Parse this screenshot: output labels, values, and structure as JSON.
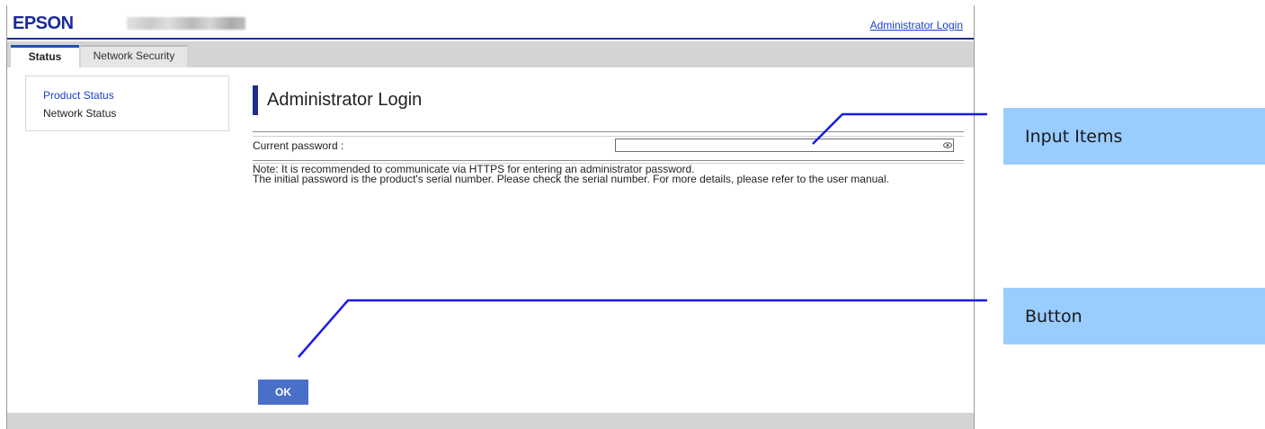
{
  "header": {
    "logo": "EPSON",
    "admin_link": "Administrator Login"
  },
  "tabs": [
    {
      "label": "Status",
      "active": true
    },
    {
      "label": "Network Security",
      "active": false
    }
  ],
  "sidebar": {
    "items": [
      {
        "label": "Product Status",
        "active": true
      },
      {
        "label": "Network Status",
        "active": false
      }
    ]
  },
  "main": {
    "title": "Administrator Login",
    "password_label": "Current password :",
    "password_value": "",
    "note_line1": "Note: It is recommended to communicate via HTTPS for entering an administrator password.",
    "note_line2": "The initial password is the product's serial number. Please check the serial number. For more details, please refer to the user manual.",
    "ok_label": "OK"
  },
  "callouts": {
    "input_items": "Input Items",
    "button": "Button"
  },
  "colors": {
    "brand": "#1a2a9c",
    "link": "#1a3fd1",
    "ok_button": "#4a6fc9",
    "callout_bg": "#99ccff",
    "leader_line": "#1a1ae6"
  },
  "icons": {
    "password_toggle": "eye-icon"
  }
}
